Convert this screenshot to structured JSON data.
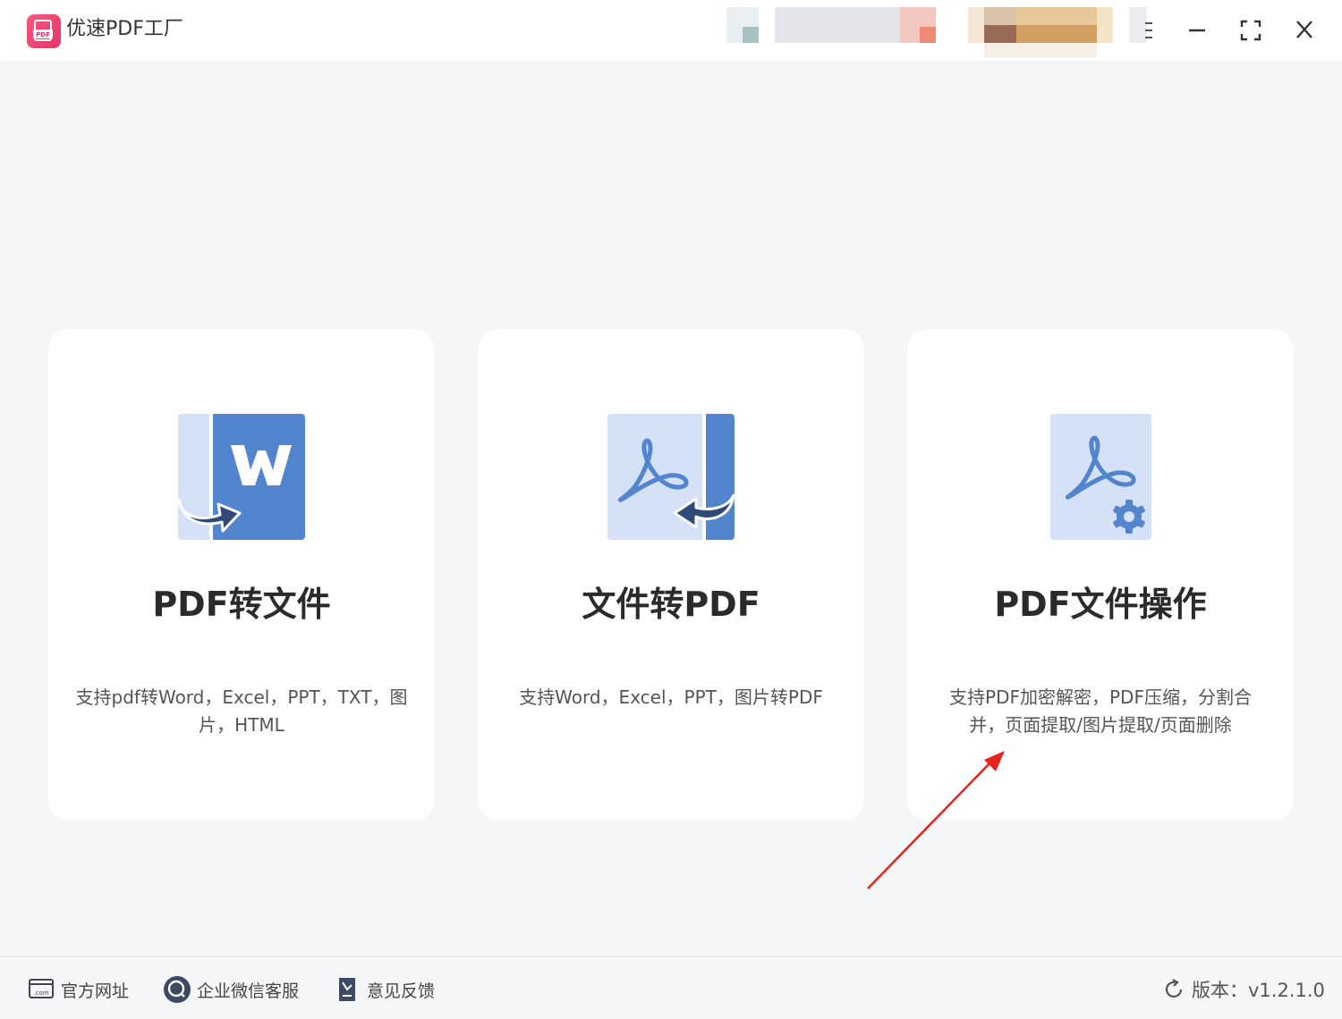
{
  "app": {
    "title": "优速PDF工厂",
    "logo_text": "PDF"
  },
  "window_controls": {
    "menu_icon": "menu-icon",
    "minimize_icon": "minimize-icon",
    "maximize_icon": "fullscreen-icon",
    "close_icon": "close-icon"
  },
  "cards": [
    {
      "title": "PDF转文件",
      "description": "支持pdf转Word，Excel，PPT，TXT，图片，HTML",
      "icon": "pdf-to-word-icon"
    },
    {
      "title": "文件转PDF",
      "description": "支持Word，Excel，PPT，图片转PDF",
      "icon": "file-to-pdf-icon"
    },
    {
      "title": "PDF文件操作",
      "description": "支持PDF加密解密，PDF压缩，分割合并，页面提取/图片提取/页面删除",
      "icon": "pdf-operations-icon"
    }
  ],
  "footer": {
    "website_label": "官方网址",
    "wechat_label": "企业微信客服",
    "feedback_label": "意见反馈",
    "version_label": "版本：v1.2.1.0"
  },
  "colors": {
    "accent_blue": "#5385cf",
    "light_blue": "#d4e1f7",
    "dark_arrow": "#2f4a7a",
    "logo_pink": "#e8336b",
    "annotation_red": "#e8231c"
  }
}
